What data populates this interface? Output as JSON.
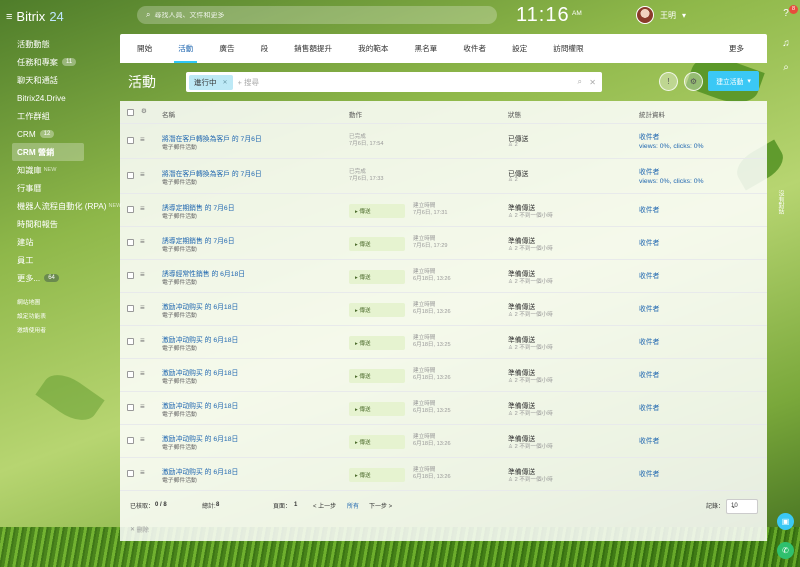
{
  "app": {
    "logo_text": "Bitrix",
    "logo_num": "24"
  },
  "header": {
    "search_placeholder": "尋找人員、文件和更多",
    "clock": "11:16",
    "clock_sub": "AM",
    "user_name": "王明",
    "notifications": "8"
  },
  "sidebar": {
    "items": [
      {
        "label": "活動動態"
      },
      {
        "label": "任務和專案",
        "counter": "11"
      },
      {
        "label": "聊天和通話"
      },
      {
        "label": "Bitrix24.Drive"
      },
      {
        "label": "工作群組"
      },
      {
        "label": "CRM",
        "counter": "12"
      },
      {
        "label": "CRM 營銷",
        "active": true
      },
      {
        "label": "知識庫",
        "sub": "NEW"
      },
      {
        "label": "行事曆"
      },
      {
        "label": "機器人流程自動化 (RPA)",
        "sub": "NEW"
      },
      {
        "label": "時間和報告"
      },
      {
        "label": "建站"
      },
      {
        "label": "員工"
      },
      {
        "label": "更多...",
        "counter": "64"
      }
    ],
    "links": [
      "網站地圖",
      "設定功能表",
      "邀請使用者"
    ]
  },
  "tabs": [
    "開始",
    "活動",
    "廣告",
    "段",
    "銷售額提升",
    "我的範本",
    "黑名單",
    "收件者",
    "設定",
    "訪問權限",
    "更多"
  ],
  "active_tab": 1,
  "toolbar": {
    "title": "活動",
    "filter_chip": "進行中",
    "search_placeholder": "+ 搜尋",
    "create_label": "建立活動"
  },
  "table": {
    "headers": {
      "name": "名稱",
      "action": "動作",
      "status": "狀態",
      "stats": "統計資料"
    },
    "rows": [
      {
        "name": "將潛在客戶轉換為客戶 的 7月6日",
        "type": "電子郵件活動",
        "action_title": "已完成",
        "action_time": "7月6日, 17:54",
        "status": "已傳送",
        "status_sub": "2",
        "recipients": "收件者",
        "stats": "views: 0%, clicks: 0%"
      },
      {
        "name": "將潛在客戶轉換為客戶 的 7月6日",
        "type": "電子郵件活動",
        "action_title": "已完成",
        "action_time": "7月6日, 17:33",
        "status": "已傳送",
        "status_sub": "2",
        "recipients": "收件者",
        "stats": "views: 0%, clicks: 0%"
      },
      {
        "name": "誘導定期銷售 的 7月6日",
        "type": "電子郵件活動",
        "button": "傳送",
        "action_title": "建立時間",
        "action_time": "7月6日, 17:31",
        "status": "準備傳送",
        "status_sub": "2  不到一個小時",
        "recipients": "收件者"
      },
      {
        "name": "誘導定期銷售 的 7月6日",
        "type": "電子郵件活動",
        "button": "傳送",
        "action_title": "建立時間",
        "action_time": "7月6日, 17:29",
        "status": "準備傳送",
        "status_sub": "2  不到一個小時",
        "recipients": "收件者"
      },
      {
        "name": "誘導經常性銷售 的 6月18日",
        "type": "電子郵件活動",
        "button": "傳送",
        "action_title": "建立時間",
        "action_time": "6月18日, 13:26",
        "status": "準備傳送",
        "status_sub": "2  不到一個小時",
        "recipients": "收件者"
      },
      {
        "name": "激励冲动购买 的 6月18日",
        "type": "電子郵件活動",
        "button": "傳送",
        "action_title": "建立時間",
        "action_time": "6月18日, 13:26",
        "status": "準備傳送",
        "status_sub": "2  不到一個小時",
        "recipients": "收件者"
      },
      {
        "name": "激励冲动购买 的 6月18日",
        "type": "電子郵件活動",
        "button": "傳送",
        "action_title": "建立時間",
        "action_time": "6月18日, 13:25",
        "status": "準備傳送",
        "status_sub": "2  不到一個小時",
        "recipients": "收件者"
      },
      {
        "name": "激励冲动购买 的 6月18日",
        "type": "電子郵件活動",
        "button": "傳送",
        "action_title": "建立時間",
        "action_time": "6月18日, 13:26",
        "status": "準備傳送",
        "status_sub": "2  不到一個小時",
        "recipients": "收件者"
      },
      {
        "name": "激励冲动购买 的 6月18日",
        "type": "電子郵件活動",
        "button": "傳送",
        "action_title": "建立時間",
        "action_time": "6月18日, 13:25",
        "status": "準備傳送",
        "status_sub": "2  不到一個小時",
        "recipients": "收件者"
      },
      {
        "name": "激励冲动购买 的 6月18日",
        "type": "電子郵件活動",
        "button": "傳送",
        "action_title": "建立時間",
        "action_time": "6月18日, 13:26",
        "status": "準備傳送",
        "status_sub": "2  不到一個小時",
        "recipients": "收件者"
      },
      {
        "name": "激励冲动购买 的 6月18日",
        "type": "電子郵件活動",
        "button": "傳送",
        "action_title": "建立時間",
        "action_time": "6月18日, 13:26",
        "status": "準備傳送",
        "status_sub": "2  不到一個小時",
        "recipients": "收件者"
      }
    ]
  },
  "footer": {
    "selected_label": "已核取：",
    "selected_value": "0 / 8",
    "total_label": "總計:",
    "total_value": "8",
    "page_label": "頁面：",
    "page_value": "1",
    "prev": "< 上一步",
    "all": "所有",
    "next": "下一步 >",
    "records_label": "記錄：",
    "records_value": "10"
  },
  "delete_label": "删除",
  "rail": {
    "vertical_text": "沒有對話"
  }
}
